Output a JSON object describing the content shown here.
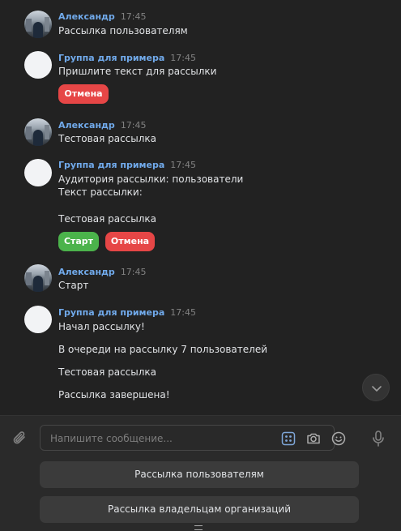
{
  "messages": [
    {
      "author": "Александр",
      "time": "17:45",
      "lines": [
        "Рассылка пользователям"
      ]
    },
    {
      "author": "Группа для примера",
      "time": "17:45",
      "lines": [
        "Пришлите текст для рассылки"
      ],
      "buttons": [
        "Отмена"
      ]
    },
    {
      "author": "Александр",
      "time": "17:45",
      "lines": [
        "Тестовая рассылка"
      ]
    },
    {
      "author": "Группа для примера",
      "time": "17:45",
      "lines": [
        "Аудитория рассылки: пользователи",
        "Текст рассылки:",
        "Тестовая рассылка"
      ],
      "buttons": [
        "Старт",
        "Отмена"
      ]
    },
    {
      "author": "Александр",
      "time": "17:45",
      "lines": [
        "Старт"
      ]
    },
    {
      "author": "Группа для примера",
      "time": "17:45",
      "lines": [
        "Начал рассылку!",
        "В очереди на рассылку 7 пользователей",
        "Тестовая рассылка",
        "Рассылка завершена!"
      ]
    }
  ],
  "composer": {
    "placeholder": "Напишите сообщение..."
  },
  "keyboard": [
    "Рассылка пользователям",
    "Рассылка владельцам организаций"
  ],
  "colors": {
    "author": "#71aaeb",
    "cancel": "#e64646",
    "start": "#4bb34b",
    "background": "#222222"
  },
  "icons": [
    "paperclip-icon",
    "bot-keyboard-icon",
    "camera-icon",
    "emoji-icon",
    "microphone-icon",
    "chevron-down-icon"
  ]
}
